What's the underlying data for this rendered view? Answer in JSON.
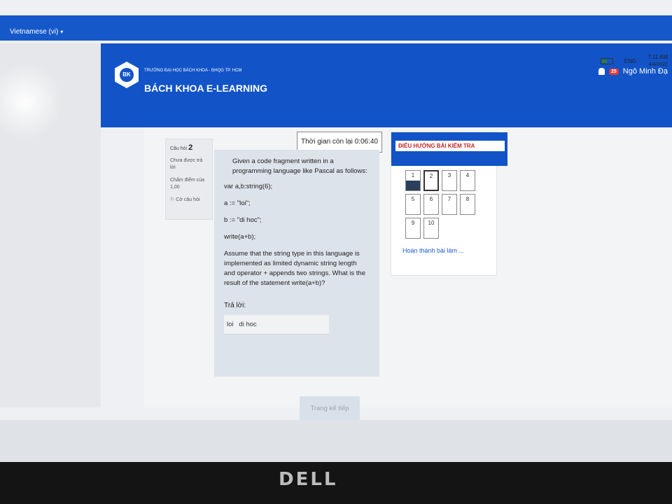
{
  "topbar": {
    "language": "Vietnamese (vi)"
  },
  "header": {
    "school_subtitle": "TRƯỜNG ĐẠI HỌC BÁCH KHOA - ĐHQG TP. HCM",
    "school_name": "BÁCH KHOA E-LEARNING",
    "logo_text": "BK",
    "notification_count": "25",
    "user_name": "Ngô Minh Đạ"
  },
  "quiz_info": {
    "question_label": "Câu hỏi",
    "question_number": "2",
    "status": "Chưa được trả lời",
    "marks": "Chấm điểm của 1,00",
    "flag_label": "Cờ câu hỏi"
  },
  "timer": {
    "text": "Thời gian còn lại 0:06:40"
  },
  "question": {
    "intro": "Given a code fragment written in a programming language like Pascal as follows:",
    "code_lines": [
      "var a,b:string(6);",
      "a := \"loi\";",
      "b := \"di hoc\";",
      "write(a+b);"
    ],
    "body": "Assume that the string type in this language is implemented as limited dynamic string length and operator + appends two strings. What is the result of the statement write(a+b)?",
    "answer_label": "Trả lời:",
    "answer_value": "loi   di hoc"
  },
  "navigation": {
    "title": "ĐIỀU HƯỚNG BÀI KIỂM TRA",
    "questions": [
      "1",
      "2",
      "3",
      "4",
      "5",
      "6",
      "7",
      "8",
      "9",
      "10"
    ],
    "finish_link": "Hoàn thành bài làm ..."
  },
  "next_button": "Trang kế tiếp",
  "taskbar": {
    "language": "ENG",
    "time": "7:11 AM",
    "date": "4/4/2022"
  },
  "bezel": {
    "brand": "DELL"
  },
  "colors": {
    "primary": "#1254c8",
    "nav_title": "#c62828",
    "answered_fill": "#2b3f5c"
  }
}
